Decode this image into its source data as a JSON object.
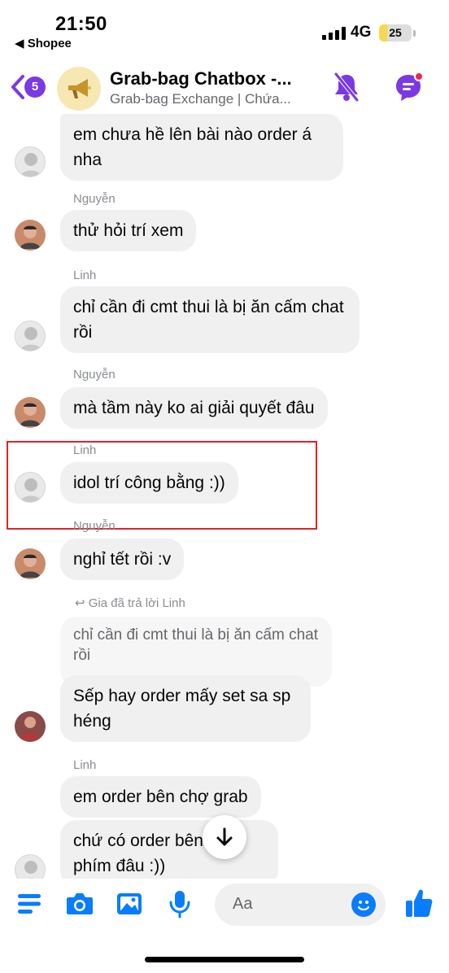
{
  "status_bar": {
    "time": "21:50",
    "back_app": "◀ Shopee",
    "network": "4G",
    "battery": "25",
    "battery_level": 0.25
  },
  "header": {
    "unread_badge": "5",
    "title": "Grab-bag Chatbox -...",
    "subtitle": "Grab-bag Exchange | Chứa...",
    "icons": [
      "back-chevron-icon",
      "megaphone-icon",
      "bell-muted-icon",
      "messenger-chat-icon"
    ],
    "accent_color": "#7b39e5"
  },
  "messages": [
    {
      "sender": "",
      "avatar": "linh",
      "text": "em chưa hề lên bài nào order á nha"
    },
    {
      "sender": "Nguyễn",
      "avatar": "nguyen",
      "text": "thử hỏi trí xem"
    },
    {
      "sender": "Linh",
      "avatar": "linh",
      "text": "chỉ cần đi cmt thui là bị ăn cấm chat rồi"
    },
    {
      "sender": "Nguyễn",
      "avatar": "nguyen",
      "text": "mà tầm này ko ai giải quyết đâu"
    },
    {
      "sender": "Linh",
      "avatar": "linh",
      "text": "idol trí công bằng :))",
      "highlighted": true
    },
    {
      "sender": "Nguyễn",
      "avatar": "nguyen",
      "text": "nghỉ tết rồi :v"
    },
    {
      "reply_note": "Gia đã trả lời Linh",
      "quoted_text": "chỉ cần đi cmt thui là bị ăn cấm chat rồi",
      "avatar": "gia",
      "text": "Sếp hay order mấy set sa sp héng"
    },
    {
      "sender": "Linh",
      "avatar": "linh",
      "text": "em order bên chợ grab"
    },
    {
      "sender": "",
      "avatar": "linh",
      "text": "chứ có order bên chợ phím đâu :))"
    }
  ],
  "composer": {
    "placeholder": "Aa",
    "icons": [
      "menu-icon",
      "camera-icon",
      "image-icon",
      "microphone-icon",
      "emoji-icon",
      "thumbs-up-icon"
    ],
    "accent_color": "#0a7cff"
  }
}
